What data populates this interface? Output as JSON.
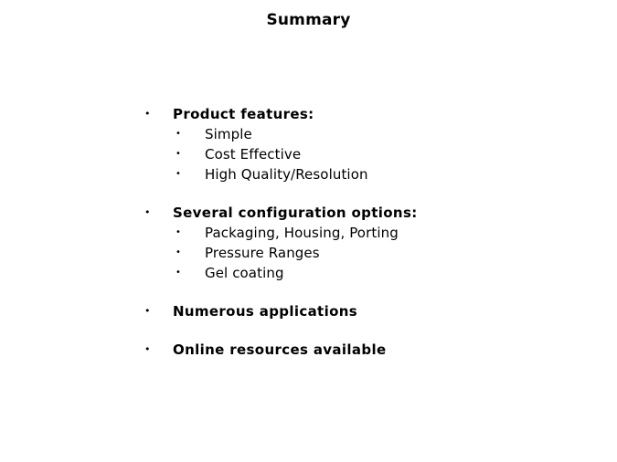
{
  "slide": {
    "title": "Summary",
    "background_color": "#ffffff",
    "text_color": "#000000",
    "bullet_glyph": "•",
    "groups": [
      {
        "heading": "Product features:",
        "items": [
          "Simple",
          "Cost Effective",
          "High Quality/Resolution"
        ]
      },
      {
        "heading": "Several configuration options:",
        "items": [
          "Packaging, Housing, Porting",
          "Pressure Ranges",
          "Gel coating"
        ]
      },
      {
        "heading": "Numerous applications",
        "items": []
      },
      {
        "heading": "Online resources available",
        "items": []
      }
    ]
  }
}
